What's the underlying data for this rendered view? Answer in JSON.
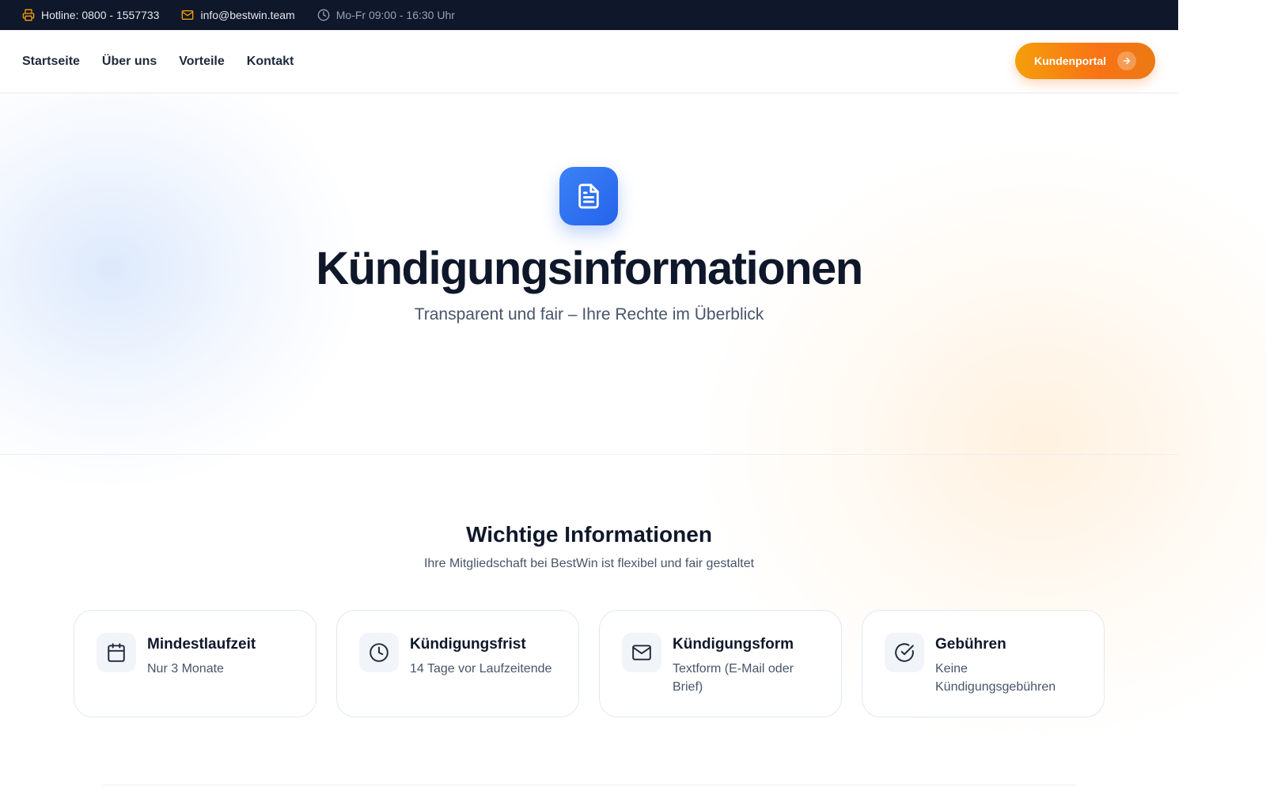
{
  "topbar": {
    "hotline": "Hotline: 0800 - 1557733",
    "email": "info@bestwin.team",
    "hours": "Mo-Fr 09:00 - 16:30 Uhr",
    "icons": [
      "printer-icon",
      "mail-icon",
      "clock-icon"
    ],
    "accent_color": "#f59e0b"
  },
  "nav": {
    "links": [
      "Startseite",
      "Über uns",
      "Vorteile",
      "Kontakt"
    ],
    "portal_label": "Kundenportal"
  },
  "hero": {
    "icon": "document-icon",
    "title": "Kündigungsinformationen",
    "subtitle": "Transparent und fair – Ihre Rechte im Überblick"
  },
  "info": {
    "title": "Wichtige Informationen",
    "subtitle": "Ihre Mitgliedschaft bei BestWin ist flexibel und fair gestaltet",
    "cards": [
      {
        "icon": "calendar-icon",
        "title": "Mindestlaufzeit",
        "desc": "Nur 3 Monate"
      },
      {
        "icon": "clock-icon",
        "title": "Kündigungsfrist",
        "desc": "14 Tage vor Laufzeitende"
      },
      {
        "icon": "mail-icon",
        "title": "Kündigungsform",
        "desc": "Textform (E-Mail oder Brief)"
      },
      {
        "icon": "check-circle-icon",
        "title": "Gebühren",
        "desc": "Keine Kündigungsgebühren"
      }
    ]
  },
  "colors": {
    "topbar_bg": "#0f172a",
    "primary_blue": "#2563eb",
    "accent_orange": "#f97316"
  }
}
